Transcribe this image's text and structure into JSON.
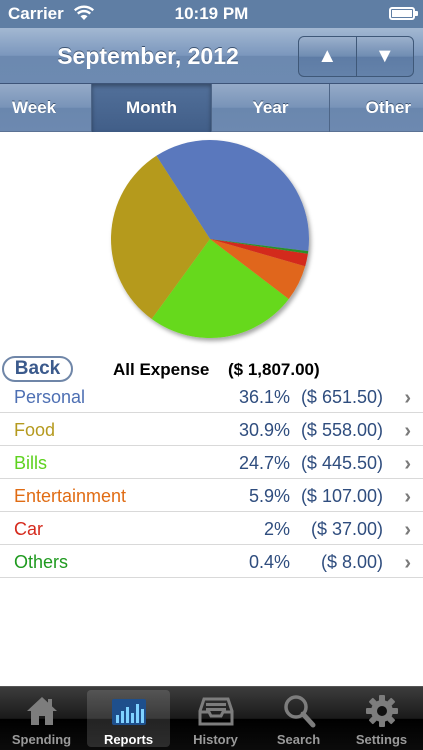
{
  "status_bar": {
    "carrier": "Carrier",
    "time": "10:19 PM"
  },
  "nav": {
    "title": "September, 2012",
    "up_arrow": "▲",
    "down_arrow": "▼"
  },
  "period_tabs": [
    {
      "label": "Week"
    },
    {
      "label": "Month",
      "selected": true
    },
    {
      "label": "Year"
    },
    {
      "label": "Other"
    }
  ],
  "summary": {
    "back_label": "Back",
    "label": "All Expense",
    "total": "($ 1,807.00)"
  },
  "categories": [
    {
      "name": "Personal",
      "percent": "36.1%",
      "amount": "($ 651.50)",
      "color": "#4d6fb3"
    },
    {
      "name": "Food",
      "percent": "30.9%",
      "amount": "($ 558.00)",
      "color": "#b59a1f"
    },
    {
      "name": "Bills",
      "percent": "24.7%",
      "amount": "($ 445.50)",
      "color": "#5ed21f"
    },
    {
      "name": "Entertainment",
      "percent": "5.9%",
      "amount": "($ 107.00)",
      "color": "#e06c14"
    },
    {
      "name": "Car",
      "percent": "2%",
      "amount": "($ 37.00)",
      "color": "#d52a1d"
    },
    {
      "name": "Others",
      "percent": "0.4%",
      "amount": "($ 8.00)",
      "color": "#1f9a1f"
    }
  ],
  "chart_data": {
    "type": "pie",
    "categories": [
      "Personal",
      "Food",
      "Bills",
      "Entertainment",
      "Car",
      "Others"
    ],
    "values": [
      651.5,
      558.0,
      445.5,
      107.0,
      37.0,
      8.0
    ],
    "colors": [
      "#5a78bd",
      "#b59a1f",
      "#66d91c",
      "#e0661a",
      "#d32a1a",
      "#2a8f2a"
    ]
  },
  "tab_bar": [
    {
      "label": "Spending",
      "icon": "house-icon"
    },
    {
      "label": "Reports",
      "icon": "bar-chart-icon",
      "active": true
    },
    {
      "label": "History",
      "icon": "inbox-tray-icon"
    },
    {
      "label": "Search",
      "icon": "magnifier-icon"
    },
    {
      "label": "Settings",
      "icon": "gear-icon"
    }
  ]
}
